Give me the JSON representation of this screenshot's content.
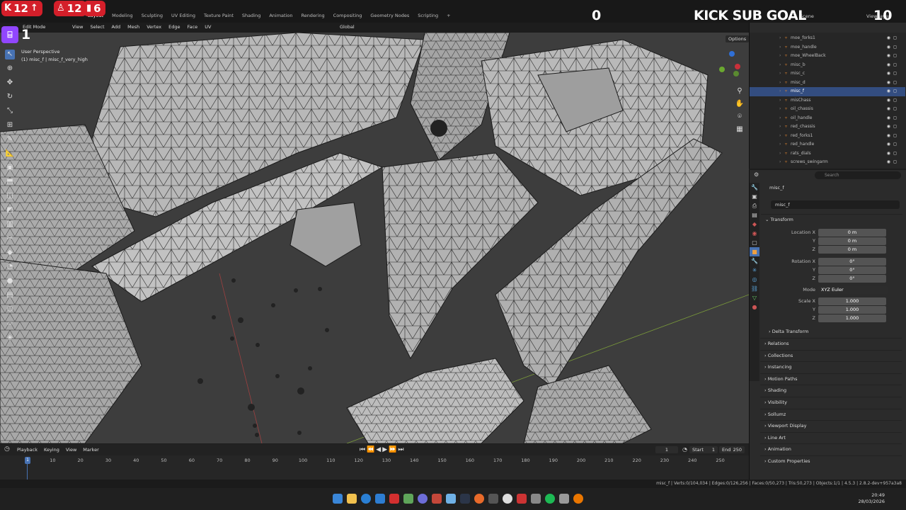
{
  "overlay": {
    "kicks": "12",
    "subs": "12",
    "viewers": "6",
    "twitch_count": "1",
    "goal_current": "0",
    "goal_label": "KICK SUB GOAL",
    "goal_target": "10",
    "badge_color": "#d41f2a",
    "twitch_color": "#9146ff"
  },
  "workspaces": [
    "Layout",
    "Modeling",
    "Sculpting",
    "UV Editing",
    "Texture Paint",
    "Shading",
    "Animation",
    "Rendering",
    "Compositing",
    "Geometry Nodes",
    "Scripting",
    "+"
  ],
  "scene_label": "Scene",
  "view_layer_label": "ViewLayer",
  "viewport": {
    "mode": "Edit Mode",
    "menu": [
      "View",
      "Select",
      "Add",
      "Mesh",
      "Vertex",
      "Edge",
      "Face",
      "UV"
    ],
    "orientation": "Global",
    "options": "Options",
    "info_line1": "User Perspective",
    "info_line2": "(1) misc_f | misc_f_very_high",
    "gizmo_axes": [
      "X",
      "Y",
      "Z"
    ]
  },
  "timeline": {
    "menu": [
      "Playback",
      "Keying",
      "View",
      "Marker"
    ],
    "current_frame": "1",
    "start_label": "Start",
    "start": "1",
    "end_label": "End",
    "end": "250",
    "frame_ticks": [
      "10",
      "20",
      "30",
      "40",
      "50",
      "60",
      "70",
      "80",
      "90",
      "100",
      "110",
      "120",
      "130",
      "140",
      "150",
      "160",
      "170",
      "180",
      "190",
      "200",
      "210",
      "220",
      "230",
      "240",
      "250"
    ],
    "cursor_frame": "1"
  },
  "status": {
    "text": "misc_f | Verts:0/104,034 | Edges:0/126,256 | Faces:0/50,273 | Tris:50,273 | Objects:1/1 | 4.5.3 | 2.8.2-dev+957a3a8"
  },
  "outliner": {
    "rows": [
      {
        "name": "moe_forks1",
        "selected": false
      },
      {
        "name": "moe_handle",
        "selected": false
      },
      {
        "name": "moe_WheelBack",
        "selected": false
      },
      {
        "name": "misc_b",
        "selected": false
      },
      {
        "name": "misc_c",
        "selected": false
      },
      {
        "name": "misc_d",
        "selected": false
      },
      {
        "name": "misc_f",
        "selected": true
      },
      {
        "name": "misChass",
        "selected": false
      },
      {
        "name": "oil_chassis",
        "selected": false
      },
      {
        "name": "oil_handle",
        "selected": false
      },
      {
        "name": "red_chassis",
        "selected": false
      },
      {
        "name": "red_forks1",
        "selected": false
      },
      {
        "name": "red_handle",
        "selected": false
      },
      {
        "name": "rats_dials",
        "selected": false
      },
      {
        "name": "screws_swingarm",
        "selected": false
      }
    ]
  },
  "properties": {
    "search_placeholder": "Search",
    "object_name": "misc_f",
    "object_field": "misc_f",
    "transform_label": "Transform",
    "location_label": "Location X",
    "location": [
      "0 m",
      "0 m",
      "0 m"
    ],
    "rotation_label": "Rotation X",
    "rotation": [
      "0°",
      "0°",
      "0°"
    ],
    "mode_label": "Mode",
    "mode_value": "XYZ Euler",
    "scale_label": "Scale X",
    "scale": [
      "1.000",
      "1.000",
      "1.000"
    ],
    "axis_y": "Y",
    "axis_z": "Z",
    "delta_transform": "Delta Transform",
    "sections": [
      "Relations",
      "Collections",
      "Instancing",
      "Motion Paths",
      "Shading",
      "Visibility",
      "Sollumz",
      "Viewport Display",
      "Line Art",
      "Animation",
      "Custom Properties"
    ]
  },
  "clock": {
    "time": "20:49",
    "date": "28/03/2026"
  },
  "colors": {
    "accent": "#4772b3",
    "viewport_bg": "#3d3d3d",
    "mesh_face": "#b5b5b5",
    "wire": "#1a1a1a"
  }
}
